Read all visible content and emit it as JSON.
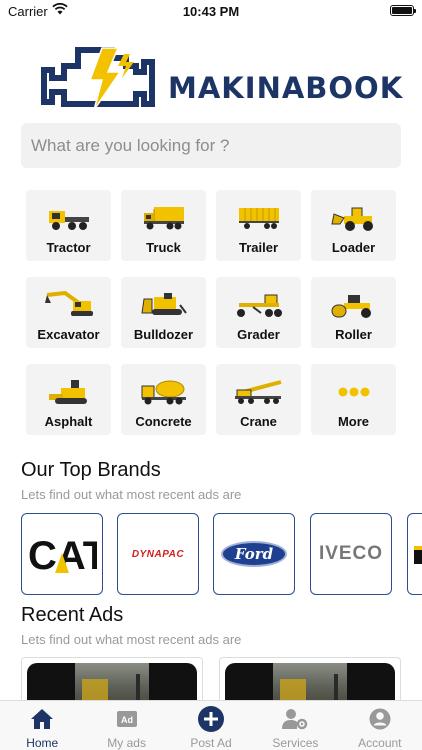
{
  "status_bar": {
    "carrier": "Carrier",
    "time": "10:43 PM"
  },
  "logo": {
    "text": "MAKINABOOK"
  },
  "search": {
    "placeholder": "What are you looking for ?"
  },
  "categories": [
    {
      "label": "Tractor",
      "icon": "tractor-icon"
    },
    {
      "label": "Truck",
      "icon": "truck-icon"
    },
    {
      "label": "Trailer",
      "icon": "trailer-icon"
    },
    {
      "label": "Loader",
      "icon": "loader-icon"
    },
    {
      "label": "Excavator",
      "icon": "excavator-icon"
    },
    {
      "label": "Bulldozer",
      "icon": "bulldozer-icon"
    },
    {
      "label": "Grader",
      "icon": "grader-icon"
    },
    {
      "label": "Roller",
      "icon": "roller-icon"
    },
    {
      "label": "Asphalt",
      "icon": "asphalt-icon"
    },
    {
      "label": "Concrete",
      "icon": "concrete-icon"
    },
    {
      "label": "Crane",
      "icon": "crane-icon"
    },
    {
      "label": "More",
      "icon": "more-dots-icon"
    }
  ],
  "top_brands": {
    "title": "Our Top Brands",
    "subtitle": "Lets find out what most recent ads are",
    "items": [
      "CAT",
      "DYNAPAC",
      "Ford",
      "IVECO"
    ]
  },
  "recent_ads": {
    "title": "Recent Ads",
    "subtitle": "Lets find out what most recent ads are"
  },
  "tabs": [
    {
      "label": "Home",
      "icon": "home-icon",
      "active": true
    },
    {
      "label": "My ads",
      "icon": "ad-icon",
      "active": false
    },
    {
      "label": "Post Ad",
      "icon": "plus-circle-icon",
      "active": false
    },
    {
      "label": "Services",
      "icon": "user-gear-icon",
      "active": false
    },
    {
      "label": "Account",
      "icon": "account-icon",
      "active": false
    }
  ],
  "colors": {
    "brand_navy": "#1d3566",
    "machine_yellow": "#f2c200",
    "tile_bg": "#f3f3f3"
  }
}
